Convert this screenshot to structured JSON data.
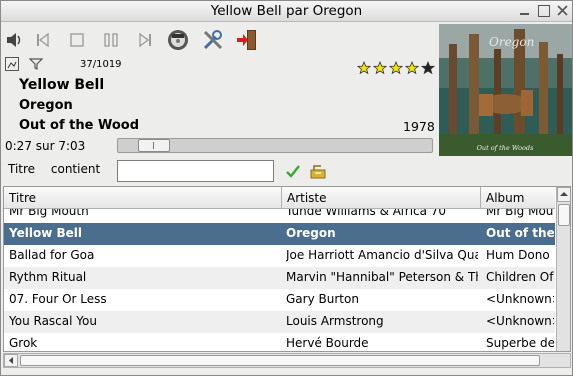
{
  "window": {
    "title": "Yellow Bell par Oregon"
  },
  "toolbar": {
    "icons": [
      "volume-icon",
      "previous-icon",
      "stop-icon",
      "pause-icon",
      "next-icon",
      "eject-disc-icon",
      "settings-tools-icon",
      "exit-icon"
    ]
  },
  "track": {
    "position": "37/1019",
    "title": "Yellow Bell",
    "artist": "Oregon",
    "album": "Out of the Wood",
    "year": "1978",
    "time": "0:27 sur 7:03",
    "progress_fraction": 0.064,
    "rating": 4,
    "rating_max": 5
  },
  "cover": {
    "band_text": "Oregon",
    "album_text": "Out of the Woods"
  },
  "filter": {
    "field": "Titre",
    "operator": "contient",
    "value": ""
  },
  "table": {
    "headers": [
      "Titre",
      "Artiste",
      "Album"
    ],
    "rows": [
      [
        "Mr Big Mouth",
        "Tunde Williams & Africa 70",
        "Mr Big Mouth"
      ],
      [
        "Yellow Bell",
        "Oregon",
        "Out of the Wood"
      ],
      [
        "Ballad for Goa",
        "Joe Harriott Amancio d'Silva Quartet",
        "Hum Dono"
      ],
      [
        "Rythm Ritual",
        "Marvin \"Hannibal\" Peterson & The Sunrise Orchestra",
        "Children Of The Fire"
      ],
      [
        "07. Four Or Less",
        "Gary Burton",
        "<Unknown>"
      ],
      [
        "You Rascal You",
        "Louis Armstrong",
        "<Unknown>"
      ],
      [
        "Grok",
        "Hervé Bourde",
        "Superbe de l'anarchie"
      ]
    ],
    "selected_index": 1
  },
  "colors": {
    "selected_row": "#4b6d8e",
    "alt_row": "#efefef",
    "accept_check": "#3aa830",
    "star_fill": "#f5e600"
  }
}
